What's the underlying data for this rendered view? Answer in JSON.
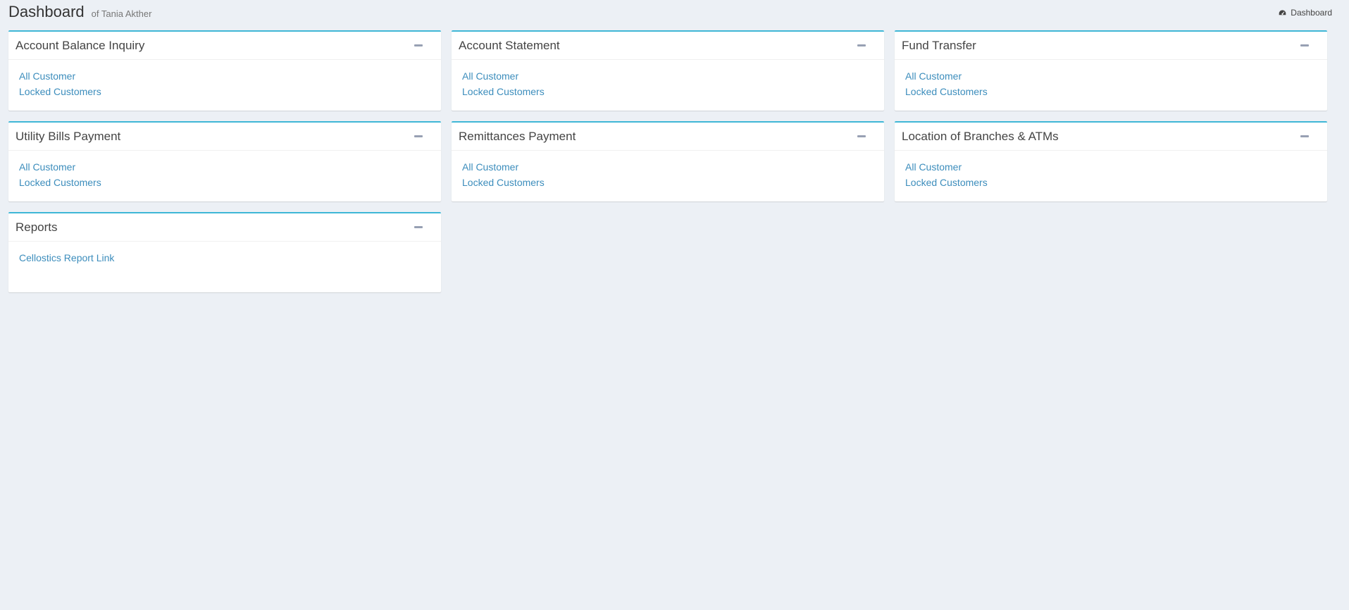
{
  "header": {
    "title": "Dashboard",
    "subtitle": "of Tania Akther"
  },
  "breadcrumb": {
    "icon": "dashboard-icon",
    "label": "Dashboard"
  },
  "colors": {
    "background": "#ecf0f5",
    "box_border_accent": "#3fb7d6",
    "link": "#3c8dbc",
    "collapse_icon": "#97a0b3"
  },
  "boxes": [
    {
      "title": "Account Balance Inquiry",
      "links": [
        "All Customer",
        "Locked Customers"
      ]
    },
    {
      "title": "Account Statement",
      "links": [
        "All Customer",
        "Locked Customers"
      ]
    },
    {
      "title": "Fund Transfer",
      "links": [
        "All Customer",
        "Locked Customers"
      ]
    },
    {
      "title": "Utility Bills Payment",
      "links": [
        "All Customer",
        "Locked Customers"
      ]
    },
    {
      "title": "Remittances Payment",
      "links": [
        "All Customer",
        "Locked Customers"
      ]
    },
    {
      "title": "Location of Branches & ATMs",
      "links": [
        "All Customer",
        "Locked Customers"
      ]
    },
    {
      "title": "Reports",
      "links": [
        "Cellostics Report Link"
      ]
    }
  ]
}
